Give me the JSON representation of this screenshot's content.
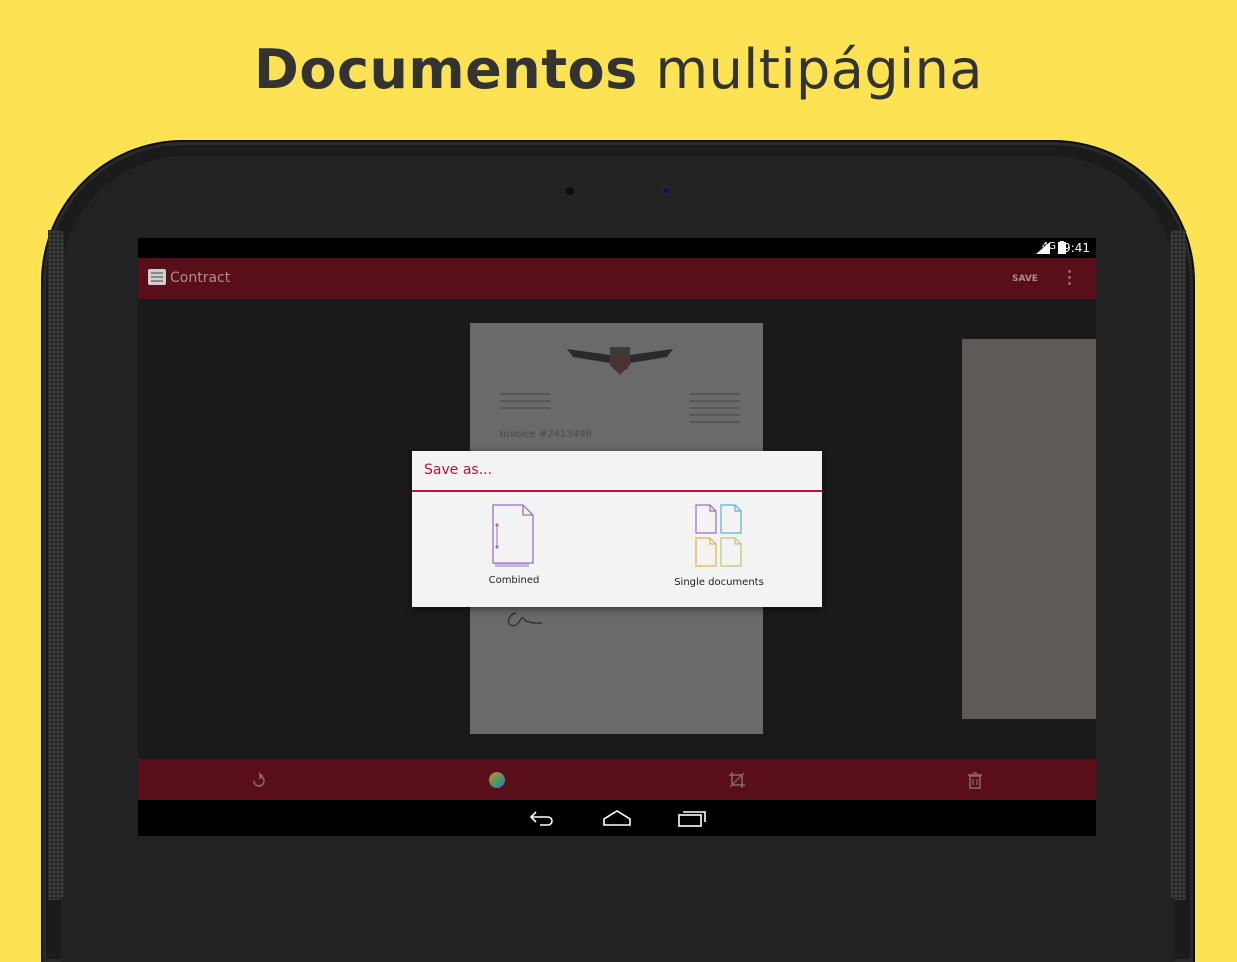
{
  "headline": {
    "bold": "Documentos",
    "light": "multipágina"
  },
  "colors": {
    "background": "#fde354",
    "primary": "#5a0e1a",
    "accent": "#b3163e"
  },
  "status_bar": {
    "network": "4G",
    "time": "9:41"
  },
  "action_bar": {
    "title": "Contract",
    "save_label": "SAVE",
    "icons": [
      "app-icon",
      "overflow-menu-icon"
    ]
  },
  "document": {
    "invoice_text": "Invoice #2413498"
  },
  "dialog": {
    "title": "Save as...",
    "options": [
      {
        "label": "Combined",
        "icon": "combined-document-icon"
      },
      {
        "label": "Single documents",
        "icon": "single-documents-icon"
      }
    ]
  },
  "bottom_bar": {
    "icons": [
      "rotate-icon",
      "color-filter-icon",
      "crop-icon",
      "delete-icon"
    ]
  },
  "nav_bar": {
    "icons": [
      "back-icon",
      "home-icon",
      "recents-icon"
    ]
  }
}
